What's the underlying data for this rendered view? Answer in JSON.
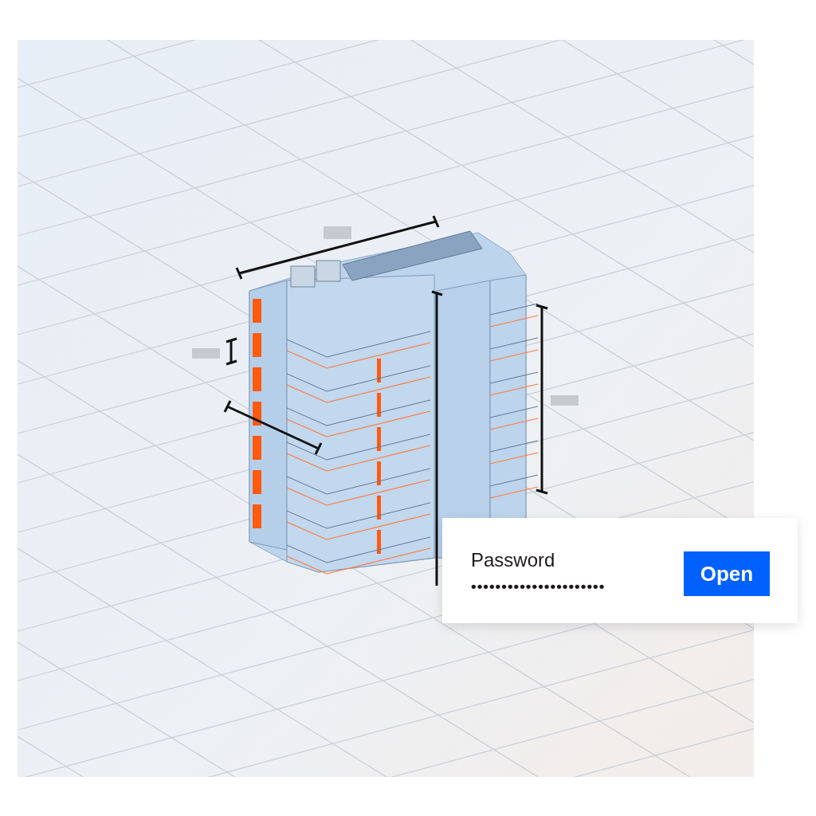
{
  "password_dialog": {
    "label": "Password",
    "value": "••••••••••••••••••••••",
    "button": "Open"
  }
}
